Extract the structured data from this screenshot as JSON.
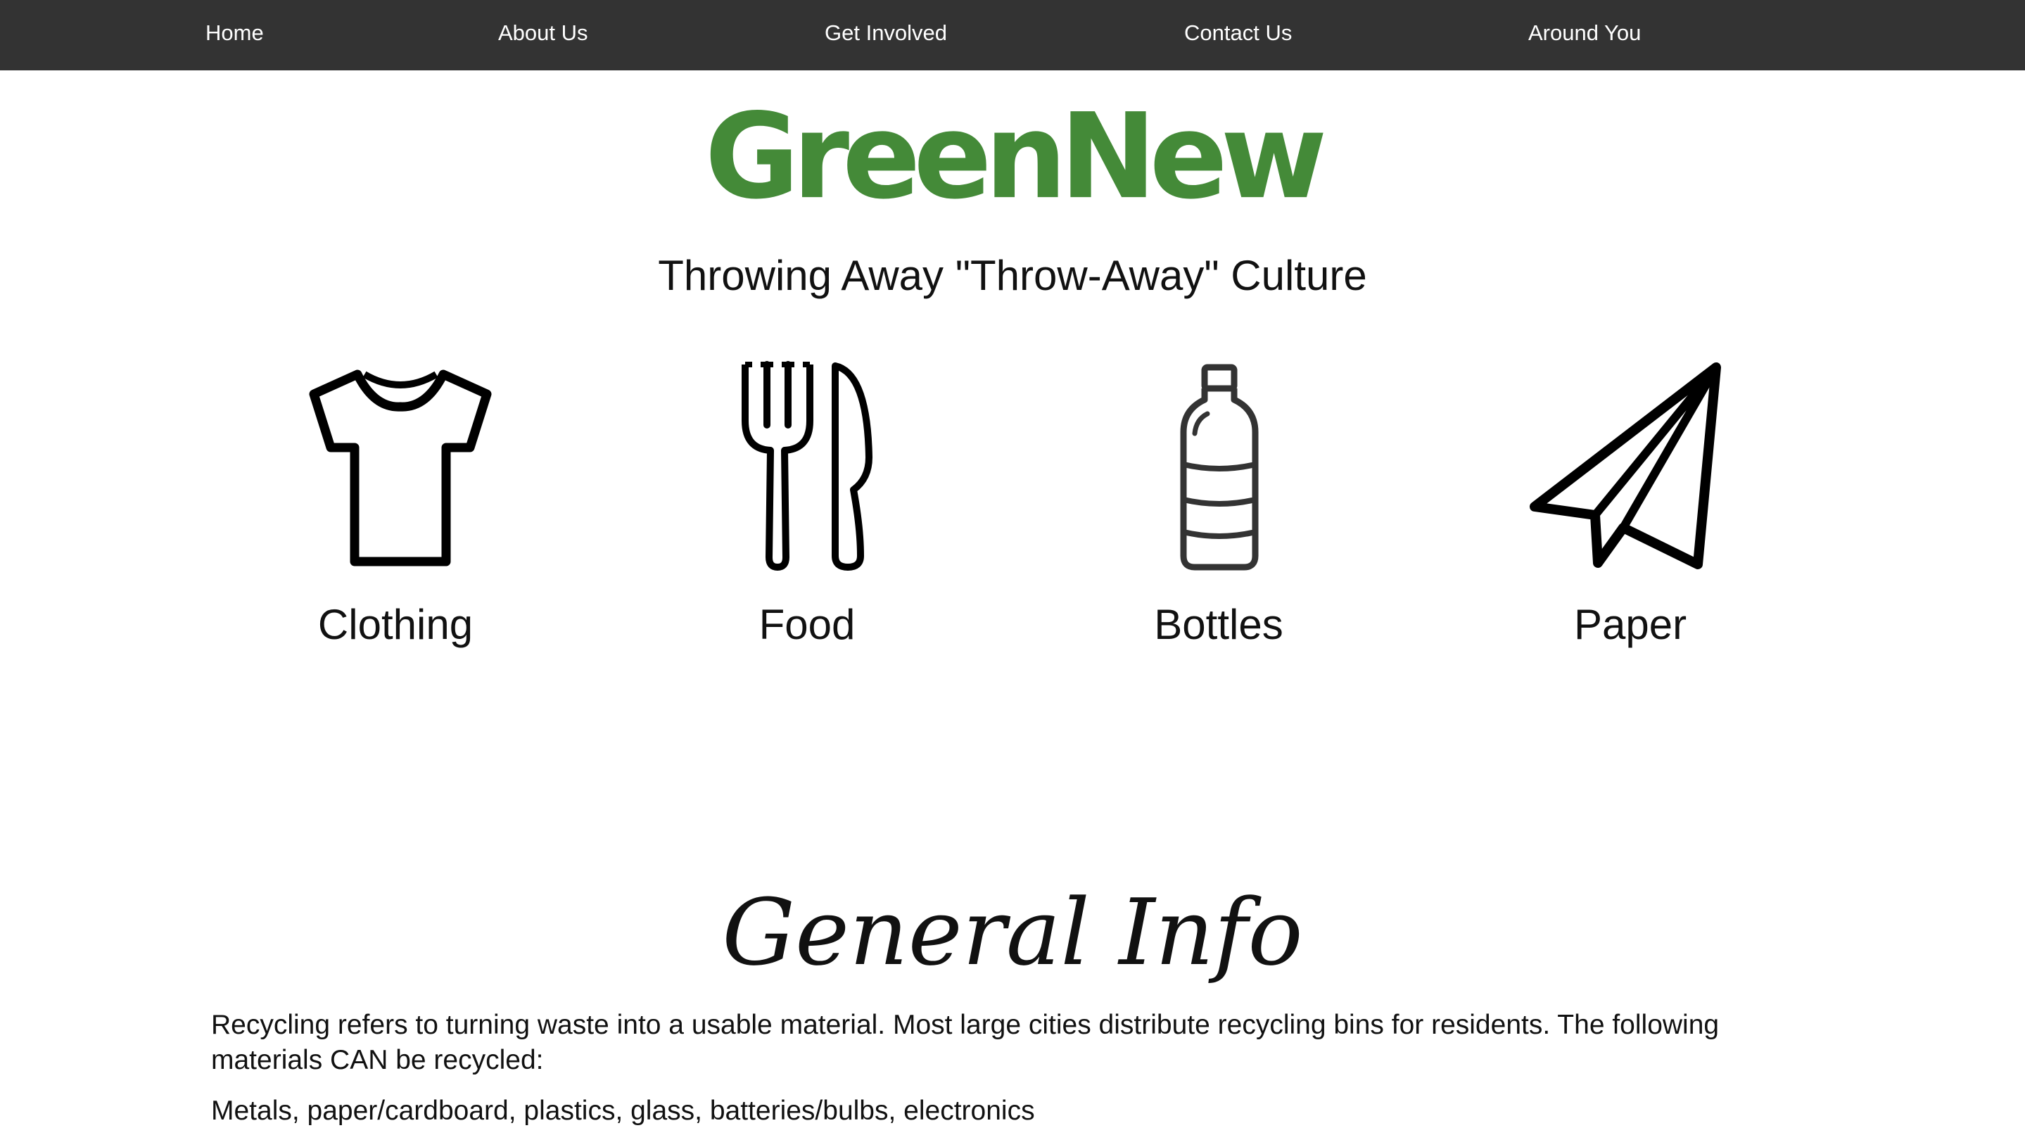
{
  "nav": {
    "items": [
      {
        "label": "Home"
      },
      {
        "label": "About Us"
      },
      {
        "label": "Get Involved"
      },
      {
        "label": "Contact Us"
      },
      {
        "label": "Around You"
      }
    ]
  },
  "header": {
    "logo": "GreenNew",
    "tagline": "Throwing Away \"Throw-Away\" Culture"
  },
  "categories": [
    {
      "label": "Clothing",
      "icon": "tshirt-icon"
    },
    {
      "label": "Food",
      "icon": "fork-knife-icon"
    },
    {
      "label": "Bottles",
      "icon": "bottle-icon"
    },
    {
      "label": "Paper",
      "icon": "paper-plane-icon"
    }
  ],
  "general_info": {
    "title": "General Info",
    "paragraph1": "Recycling refers to turning waste into a usable material. Most large cities distribute recycling bins for residents. The following materials CAN be recycled:",
    "paragraph2": "Metals, paper/cardboard, plastics, glass, batteries/bulbs, electronics"
  },
  "colors": {
    "nav_background": "#333333",
    "nav_text": "#ffffff",
    "logo_green": "#448a38",
    "body_text": "#111111"
  }
}
